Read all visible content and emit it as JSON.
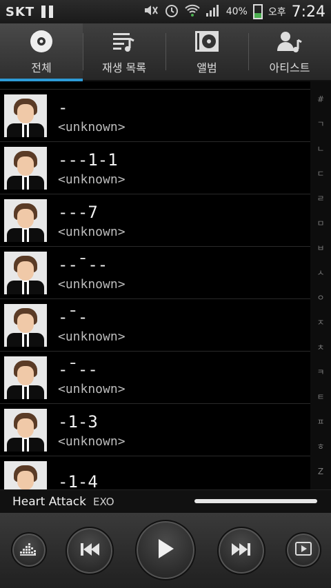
{
  "status_bar": {
    "carrier": "SKT",
    "battery_percent": "40%",
    "battery_level": 0.4,
    "time_prefix": "오후",
    "time": "7:24",
    "icons": [
      "pause-icon",
      "mute-icon",
      "alarm-icon",
      "wifi-icon",
      "signal-icon",
      "battery-icon"
    ]
  },
  "tabs": [
    {
      "label": "전체",
      "icon": "disc-icon",
      "active": true
    },
    {
      "label": "재생 목록",
      "icon": "playlist-icon",
      "active": false
    },
    {
      "label": "앨범",
      "icon": "album-icon",
      "active": false
    },
    {
      "label": "아티스트",
      "icon": "artist-icon",
      "active": false
    }
  ],
  "songs": [
    {
      "title": "-",
      "artist": "<unknown>"
    },
    {
      "title": "---1-1",
      "artist": "<unknown>"
    },
    {
      "title": "---7",
      "artist": "<unknown>"
    },
    {
      "title": "--¯--",
      "artist": "<unknown>"
    },
    {
      "title": "-¯-",
      "artist": "<unknown>"
    },
    {
      "title": "-¯--",
      "artist": "<unknown>"
    },
    {
      "title": "-1-3",
      "artist": "<unknown>"
    },
    {
      "title": "-1-4",
      "artist": ""
    }
  ],
  "index_bar": [
    "#",
    "ㄱ",
    "ㄴ",
    "ㄷ",
    "ㄹ",
    "ㅁ",
    "ㅂ",
    "ㅅ",
    "ㅇ",
    "ㅈ",
    "ㅊ",
    "ㅋ",
    "ㅌ",
    "ㅍ",
    "ㅎ",
    "Z"
  ],
  "now_playing": {
    "title": "Heart Attack",
    "artist": "EXO",
    "progress": 1.0
  },
  "controls": [
    {
      "name": "equalizer-button",
      "icon": "equalizer-icon"
    },
    {
      "name": "previous-button",
      "icon": "previous-icon"
    },
    {
      "name": "play-button",
      "icon": "play-icon"
    },
    {
      "name": "next-button",
      "icon": "next-icon"
    },
    {
      "name": "playlist-view-button",
      "icon": "queue-icon"
    }
  ]
}
